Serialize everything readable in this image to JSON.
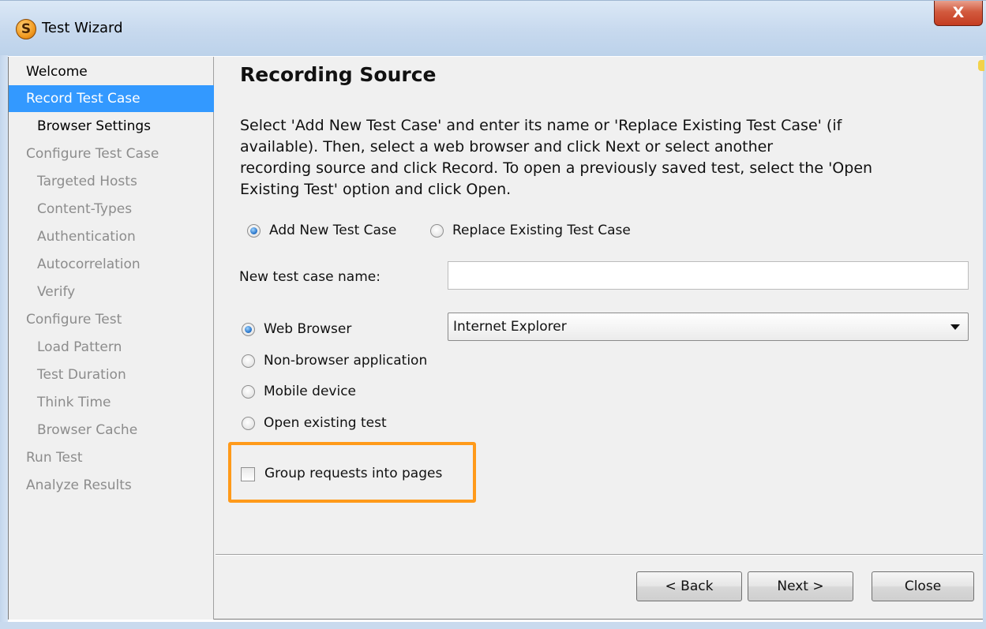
{
  "window": {
    "title": "Test Wizard",
    "app_icon_letter": "S",
    "close_glyph": "X"
  },
  "sidebar": {
    "items": [
      {
        "label": "Welcome",
        "level": 0,
        "state": "done"
      },
      {
        "label": "Record Test Case",
        "level": 0,
        "state": "active"
      },
      {
        "label": "Browser Settings",
        "level": 1,
        "state": "done"
      },
      {
        "label": "Configure Test Case",
        "level": 0,
        "state": "pending"
      },
      {
        "label": "Targeted Hosts",
        "level": 1,
        "state": "pending"
      },
      {
        "label": "Content-Types",
        "level": 1,
        "state": "pending"
      },
      {
        "label": "Authentication",
        "level": 1,
        "state": "pending"
      },
      {
        "label": "Autocorrelation",
        "level": 1,
        "state": "pending"
      },
      {
        "label": "Verify",
        "level": 1,
        "state": "pending"
      },
      {
        "label": "Configure Test",
        "level": 0,
        "state": "pending"
      },
      {
        "label": "Load Pattern",
        "level": 1,
        "state": "pending"
      },
      {
        "label": "Test Duration",
        "level": 1,
        "state": "pending"
      },
      {
        "label": "Think Time",
        "level": 1,
        "state": "pending"
      },
      {
        "label": "Browser Cache",
        "level": 1,
        "state": "pending"
      },
      {
        "label": "Run Test",
        "level": 0,
        "state": "pending"
      },
      {
        "label": "Analyze Results",
        "level": 0,
        "state": "pending"
      }
    ]
  },
  "main": {
    "heading": "Recording Source",
    "description_lines": [
      "Select 'Add New Test Case' and enter its name or 'Replace Existing Test Case' (if",
      "available). Then, select a web browser and click Next or select another",
      "recording source and click Record. To open a previously saved test, select the 'Open",
      "Existing Test' option and click Open."
    ],
    "mode_options": {
      "add_new": {
        "label": "Add New Test Case",
        "checked": true
      },
      "replace_existing": {
        "label": "Replace Existing Test Case",
        "checked": false
      }
    },
    "test_case_name": {
      "label": "New test case name:",
      "value": ""
    },
    "source_options": {
      "web_browser": {
        "label": "Web Browser",
        "checked": true
      },
      "non_browser": {
        "label": "Non-browser application",
        "checked": false
      },
      "mobile": {
        "label": "Mobile device",
        "checked": false
      },
      "open_existing": {
        "label": "Open existing test",
        "checked": false
      }
    },
    "browser_select": {
      "value": "Internet Explorer"
    },
    "group_requests": {
      "label": "Group requests into pages",
      "checked": false
    },
    "highlight_color": "#ff9a1a"
  },
  "buttons": {
    "back": "< Back",
    "next": "Next >",
    "close": "Close"
  },
  "colors": {
    "active_nav": "#3399ff",
    "pending_nav_text": "#8c8c8c",
    "close_button": "#c43c21"
  }
}
